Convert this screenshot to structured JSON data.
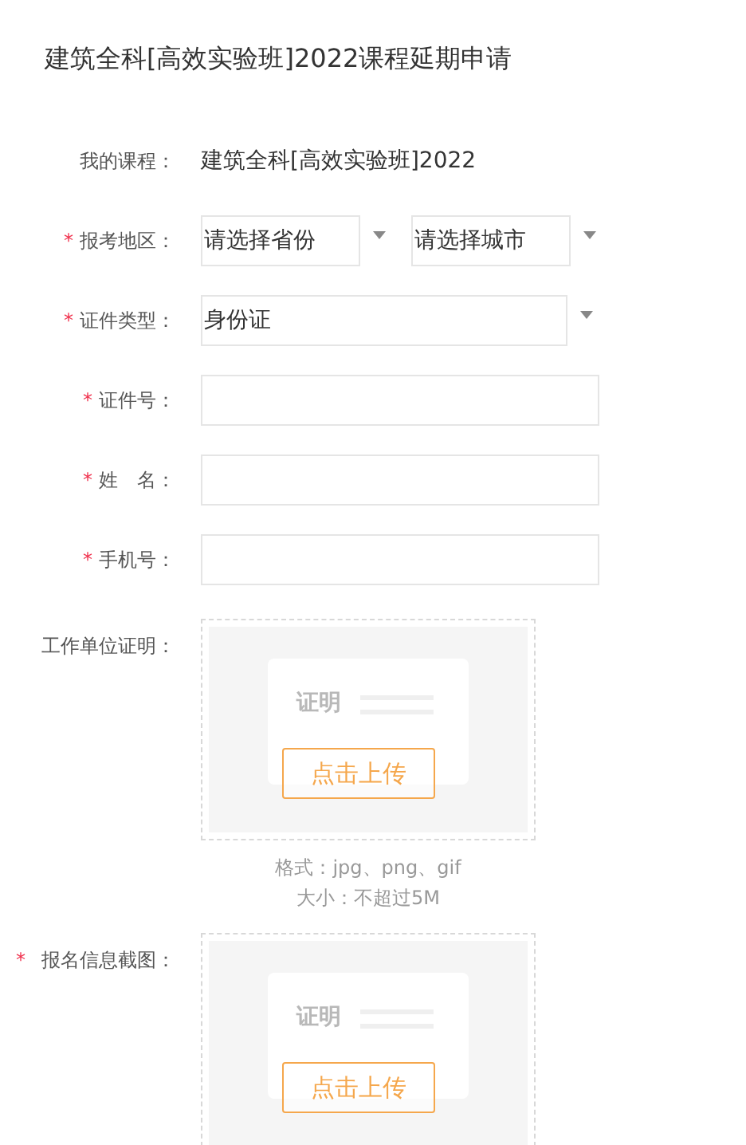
{
  "title": "建筑全科[高效实验班]2022课程延期申请",
  "course": {
    "label": "我的课程：",
    "value": "建筑全科[高效实验班]2022"
  },
  "fields": [
    {
      "kind": "double-select",
      "label": "报考地区：",
      "required_mark": "*",
      "options": [
        "请选择省份",
        "请选择城市"
      ]
    },
    {
      "kind": "select",
      "label": "证件类型：",
      "required_mark": "*",
      "options": [
        "身份证"
      ]
    },
    {
      "kind": "input",
      "label": "证件号：",
      "required_mark": "*"
    },
    {
      "kind": "input",
      "label": "姓　名：",
      "required_mark": "*"
    },
    {
      "kind": "input",
      "label": "手机号：",
      "required_mark": "*"
    }
  ],
  "uploads": [
    {
      "label": "工作单位证明：",
      "card_text": "证明",
      "button": "点击上传",
      "hints": [
        "格式：jpg、png、gif",
        "大小：不超过5M"
      ]
    },
    {
      "label": "报名信息截图：",
      "required_mark": "*",
      "card_text": "证明",
      "button": "点击上传"
    }
  ]
}
